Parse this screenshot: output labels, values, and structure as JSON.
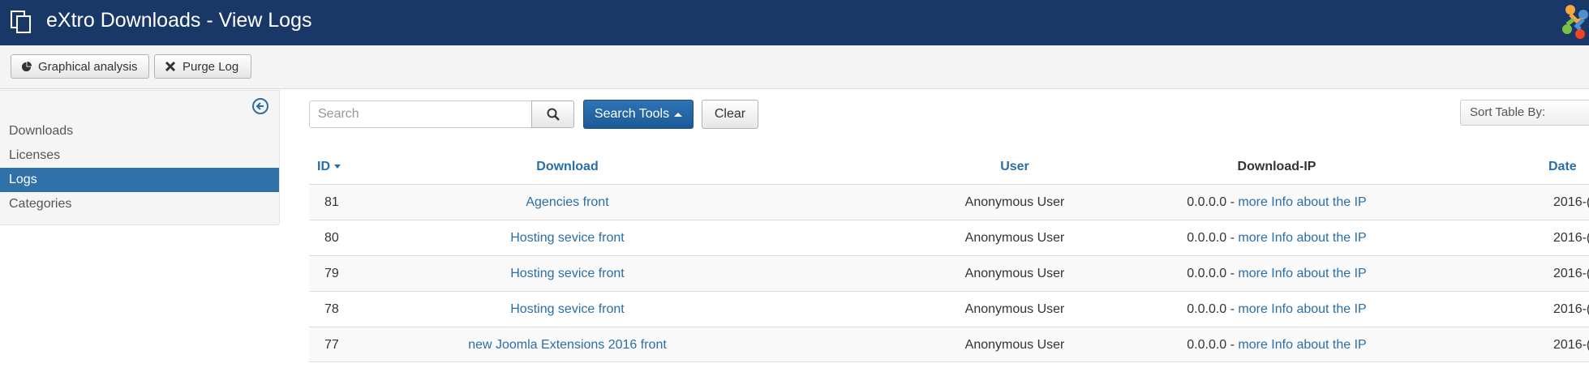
{
  "header": {
    "title": "eXtro Downloads - View Logs",
    "icon": "copy-icon",
    "logo": "joomla-logo",
    "color": "#1a3867"
  },
  "toolbar": {
    "graph_label": "Graphical analysis",
    "graph_icon": "pie-chart-icon",
    "purge_label": "Purge Log",
    "purge_icon": "close-icon"
  },
  "sidebar": {
    "collapse_icon": "arrow-left-circle-icon",
    "items": [
      {
        "label": "Downloads",
        "active": false
      },
      {
        "label": "Licenses",
        "active": false
      },
      {
        "label": "Logs",
        "active": true
      },
      {
        "label": "Categories",
        "active": false
      }
    ]
  },
  "search": {
    "placeholder": "Search",
    "value": "",
    "search_icon": "search-icon",
    "tools_label": "Search Tools",
    "clear_label": "Clear"
  },
  "sort": {
    "selected": "Sort Table By:"
  },
  "table": {
    "headers": {
      "id": "ID",
      "download": "Download",
      "user": "User",
      "ip": "Download-IP",
      "date": "Date"
    },
    "rows": [
      {
        "id": "81",
        "download": "Agencies front",
        "user": "Anonymous User",
        "ip": "0.0.0.0 - ",
        "ip_link": "more Info about the IP",
        "date": "2016-("
      },
      {
        "id": "80",
        "download": "Hosting sevice front",
        "user": "Anonymous User",
        "ip": "0.0.0.0 - ",
        "ip_link": "more Info about the IP",
        "date": "2016-("
      },
      {
        "id": "79",
        "download": "Hosting sevice front",
        "user": "Anonymous User",
        "ip": "0.0.0.0 - ",
        "ip_link": "more Info about the IP",
        "date": "2016-("
      },
      {
        "id": "78",
        "download": "Hosting sevice front",
        "user": "Anonymous User",
        "ip": "0.0.0.0 - ",
        "ip_link": "more Info about the IP",
        "date": "2016-("
      },
      {
        "id": "77",
        "download": "new Joomla Extensions 2016 front",
        "user": "Anonymous User",
        "ip": "0.0.0.0 - ",
        "ip_link": "more Info about the IP",
        "date": "2016-("
      }
    ]
  },
  "colors": {
    "header_bg": "#1a3867",
    "link": "#2a6ea8",
    "active_item": "#3071a9",
    "primary_button": "#2f73b5"
  }
}
